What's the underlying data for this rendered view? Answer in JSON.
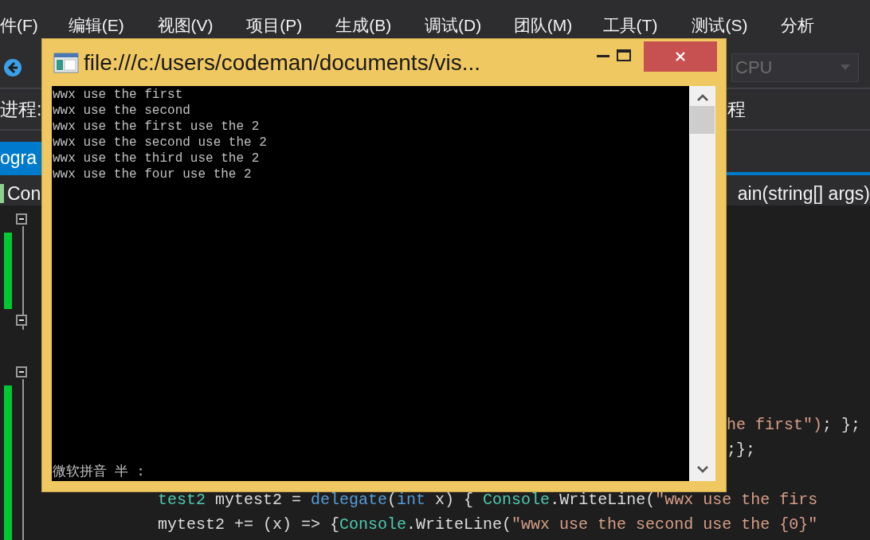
{
  "menu_bar": {
    "items": [
      "件(F)",
      "编辑(E)",
      "视图(V)",
      "项目(P)",
      "生成(B)",
      "调试(D)",
      "团队(M)",
      "工具(T)",
      "测试(S)",
      "分析"
    ]
  },
  "toolbar": {
    "platform": "CPU"
  },
  "process_bar": {
    "left": "进程:",
    "right": "程"
  },
  "tab_bar": {
    "tab": {
      "label": "ogra",
      "selected": true
    }
  },
  "nav_bar": {
    "left": "Con",
    "right": "ain(string[] args)"
  },
  "code": {
    "lines": [
      {
        "covered": true,
        "gap_before": false,
        "tokens": [
          {
            "kind": "string",
            "text": "he first\")"
          },
          {
            "kind": "plain",
            "text": "; };"
          }
        ]
      },
      {
        "covered": true,
        "gap_before": false,
        "tokens": [
          {
            "kind": "plain",
            "text": ";};"
          }
        ]
      },
      {
        "covered": false,
        "gap_before": true,
        "tokens": [
          {
            "kind": "type",
            "text": "test2"
          },
          {
            "kind": "plain",
            "text": " mytest2 = "
          },
          {
            "kind": "keyword",
            "text": "delegate"
          },
          {
            "kind": "plain",
            "text": "("
          },
          {
            "kind": "keyword",
            "text": "int"
          },
          {
            "kind": "plain",
            "text": " x) { "
          },
          {
            "kind": "type",
            "text": "Console"
          },
          {
            "kind": "plain",
            "text": ".WriteLine("
          },
          {
            "kind": "string",
            "text": "\"wwx use the firs"
          }
        ]
      },
      {
        "covered": false,
        "gap_before": false,
        "tokens": [
          {
            "kind": "plain",
            "text": "mytest2 += (x) => {"
          },
          {
            "kind": "type",
            "text": "Console"
          },
          {
            "kind": "plain",
            "text": ".WriteLine("
          },
          {
            "kind": "string",
            "text": "\"wwx use the second use the {0}\""
          }
        ]
      }
    ]
  },
  "console_window": {
    "title": "file:///c:/users/codeman/documents/vis...",
    "output": [
      "wwx use the first",
      "wwx use the second",
      "wwx use the first use the 2",
      "wwx use the second use the 2",
      "wwx use the third use the 2",
      "wwx use the four use the 2"
    ],
    "ime_status": "微软拼音 半 :"
  }
}
